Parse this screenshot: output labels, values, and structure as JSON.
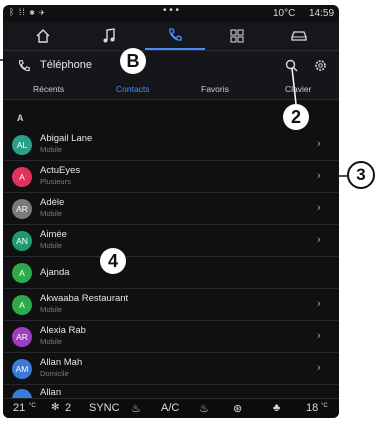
{
  "status": {
    "signal_text": "ᛒ ⁞⁞ ✱ ✈",
    "menu_dots": "• • •",
    "temperature": "10°C",
    "time": "14:59"
  },
  "nav": {
    "items": [
      "home-icon",
      "music-icon",
      "phone-icon",
      "apps-icon",
      "car-icon"
    ],
    "active": "phone"
  },
  "header": {
    "title": "Téléphone"
  },
  "tabs": [
    {
      "label": "Récents"
    },
    {
      "label": "Contacts",
      "active": true
    },
    {
      "label": "Favoris"
    },
    {
      "label": "Clavier"
    }
  ],
  "section_letter": "A",
  "contacts": [
    {
      "initials": "AL",
      "name": "Abigail Lane",
      "sub": "Mobile",
      "color": "#2aa08c"
    },
    {
      "initials": "A",
      "name": "ActuEyes",
      "sub": "Plusieurs",
      "color": "#e0325a"
    },
    {
      "initials": "AR",
      "name": "Adèle",
      "sub": "Mobile",
      "color": "#7a7a7a"
    },
    {
      "initials": "AN",
      "name": "Aimée",
      "sub": "Mobile",
      "color": "#1f9a6e"
    },
    {
      "initials": "A",
      "name": "Ajanda",
      "sub": "",
      "color": "#2eaa4a"
    },
    {
      "initials": "A",
      "name": "Akwaaba Restaurant",
      "sub": "Mobile",
      "color": "#2eaa4a"
    },
    {
      "initials": "AR",
      "name": "Alexia Rab",
      "sub": "Mobile",
      "color": "#a03cc0"
    },
    {
      "initials": "AM",
      "name": "Allan Mah",
      "sub": "Domicile",
      "color": "#3a7ad8"
    },
    {
      "initials": "",
      "name": "Allan",
      "sub": "",
      "color": "#3a7ad8"
    }
  ],
  "bottom": {
    "temp_left": "21",
    "temp_left_unit": "°C",
    "fan_level": "2",
    "sync": "SYNC",
    "ac": "A/C",
    "temp_right": "18",
    "temp_right_unit": "°C"
  },
  "callouts": {
    "b": "B",
    "two": "2",
    "three": "3",
    "four": "4"
  }
}
